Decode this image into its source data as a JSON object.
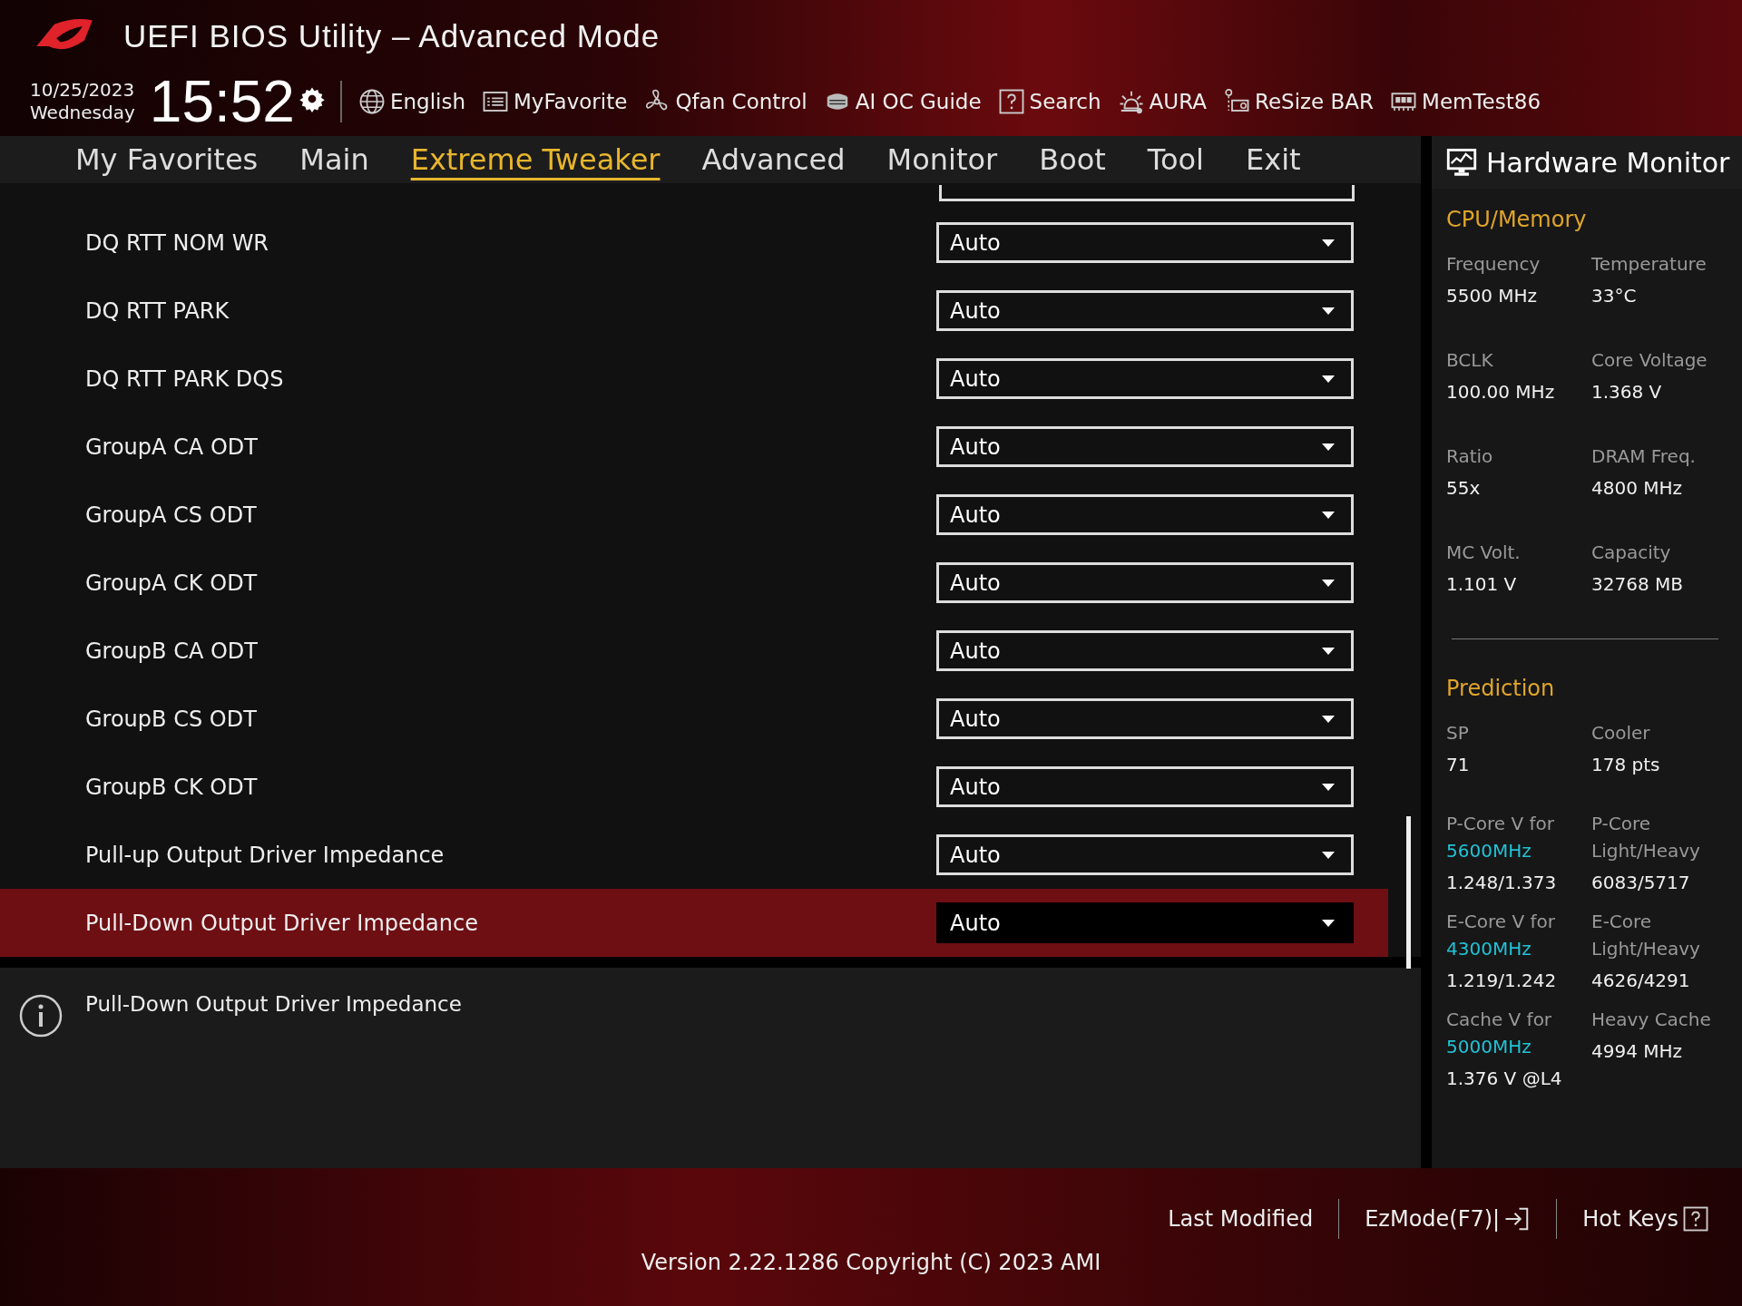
{
  "window": {
    "title": "UEFI BIOS Utility – Advanced Mode"
  },
  "clock": {
    "date": "10/25/2023",
    "weekday": "Wednesday",
    "time": "15:52"
  },
  "toolbar": [
    {
      "label": "English"
    },
    {
      "label": "MyFavorite"
    },
    {
      "label": "Qfan Control"
    },
    {
      "label": "AI OC Guide"
    },
    {
      "label": "Search"
    },
    {
      "label": "AURA"
    },
    {
      "label": "ReSize BAR"
    },
    {
      "label": "MemTest86"
    }
  ],
  "tabs": [
    {
      "label": "My Favorites",
      "selected": false
    },
    {
      "label": "Main",
      "selected": false
    },
    {
      "label": "Extreme Tweaker",
      "selected": true
    },
    {
      "label": "Advanced",
      "selected": false
    },
    {
      "label": "Monitor",
      "selected": false
    },
    {
      "label": "Boot",
      "selected": false
    },
    {
      "label": "Tool",
      "selected": false
    },
    {
      "label": "Exit",
      "selected": false
    }
  ],
  "settings": [
    {
      "label": "DQ RTT NOM WR",
      "value": "Auto",
      "selected": false
    },
    {
      "label": "DQ RTT PARK",
      "value": "Auto",
      "selected": false
    },
    {
      "label": "DQ RTT PARK DQS",
      "value": "Auto",
      "selected": false
    },
    {
      "label": "GroupA CA ODT",
      "value": "Auto",
      "selected": false
    },
    {
      "label": "GroupA CS ODT",
      "value": "Auto",
      "selected": false
    },
    {
      "label": "GroupA CK ODT",
      "value": "Auto",
      "selected": false
    },
    {
      "label": "GroupB CA ODT",
      "value": "Auto",
      "selected": false
    },
    {
      "label": "GroupB CS ODT",
      "value": "Auto",
      "selected": false
    },
    {
      "label": "GroupB CK ODT",
      "value": "Auto",
      "selected": false
    },
    {
      "label": "Pull-up Output Driver Impedance",
      "value": "Auto",
      "selected": false
    },
    {
      "label": "Pull-Down Output Driver Impedance",
      "value": "Auto",
      "selected": true
    }
  ],
  "help": {
    "text": "Pull-Down Output Driver Impedance"
  },
  "hardware_monitor": {
    "title": "Hardware Monitor",
    "sections": [
      {
        "title": "CPU/Memory",
        "items": [
          {
            "label": "Frequency",
            "value": "5500 MHz"
          },
          {
            "label": "Temperature",
            "value": "33°C"
          },
          {
            "label": "BCLK",
            "value": "100.00 MHz"
          },
          {
            "label": "Core Voltage",
            "value": "1.368 V"
          },
          {
            "label": "Ratio",
            "value": "55x"
          },
          {
            "label": "DRAM Freq.",
            "value": "4800 MHz"
          },
          {
            "label": "MC Volt.",
            "value": "1.101 V"
          },
          {
            "label": "Capacity",
            "value": "32768 MB"
          }
        ]
      },
      {
        "title": "Prediction",
        "items": [
          {
            "label": "SP",
            "value": "71"
          },
          {
            "label": "Cooler",
            "value": "178 pts"
          },
          {
            "label": "P-Core V for",
            "freq": "5600MHz",
            "value": "1.248/1.373"
          },
          {
            "label": "P-Core Light/Heavy",
            "value": "6083/5717"
          },
          {
            "label": "E-Core V for",
            "freq": "4300MHz",
            "value": "1.219/1.242"
          },
          {
            "label": "E-Core Light/Heavy",
            "value": "4626/4291"
          },
          {
            "label": "Cache V for",
            "freq": "5000MHz",
            "value": "1.376 V @L4"
          },
          {
            "label": "Heavy Cache",
            "value": "4994 MHz"
          }
        ]
      }
    ]
  },
  "footer": {
    "buttons": [
      {
        "label": "Last Modified"
      },
      {
        "label": "EzMode(F7)|"
      },
      {
        "label": "Hot Keys"
      }
    ],
    "version": "Version 2.22.1286 Copyright (C) 2023 AMI"
  }
}
